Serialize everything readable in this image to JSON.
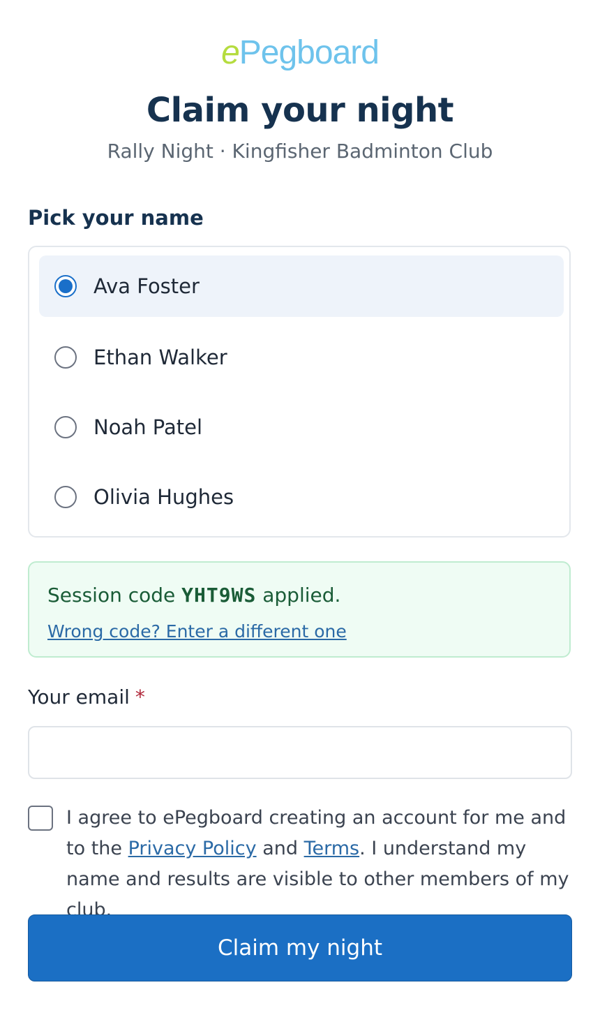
{
  "logo": {
    "prefix": "e",
    "rest": "Pegboard"
  },
  "header": {
    "title": "Claim your night",
    "subtitle": "Rally Night · Kingfisher Badminton Club"
  },
  "names": {
    "label": "Pick your name",
    "selected_index": 0,
    "items": [
      {
        "label": "Ava Foster"
      },
      {
        "label": "Ethan Walker"
      },
      {
        "label": "Noah Patel"
      },
      {
        "label": "Olivia Hughes"
      }
    ]
  },
  "session": {
    "prefix": "Session code",
    "code": "YHT9WS",
    "suffix": "applied.",
    "change_link": "Wrong code? Enter a different one"
  },
  "email": {
    "label": "Your email",
    "required_marker": "*",
    "value": ""
  },
  "agreement": {
    "checked": false,
    "text_1": "I agree to ePegboard creating an account for me and to the",
    "privacy_link": "Privacy Policy",
    "text_2": "and",
    "terms_link": "Terms",
    "text_3": ". I understand my name and results are visible to other members of my club."
  },
  "submit": {
    "label": "Claim my night"
  },
  "colors": {
    "primary": "#1b6fc4",
    "heading": "#16324f",
    "success_bg": "#effcf4",
    "selected_row_bg": "#eef3fa"
  }
}
